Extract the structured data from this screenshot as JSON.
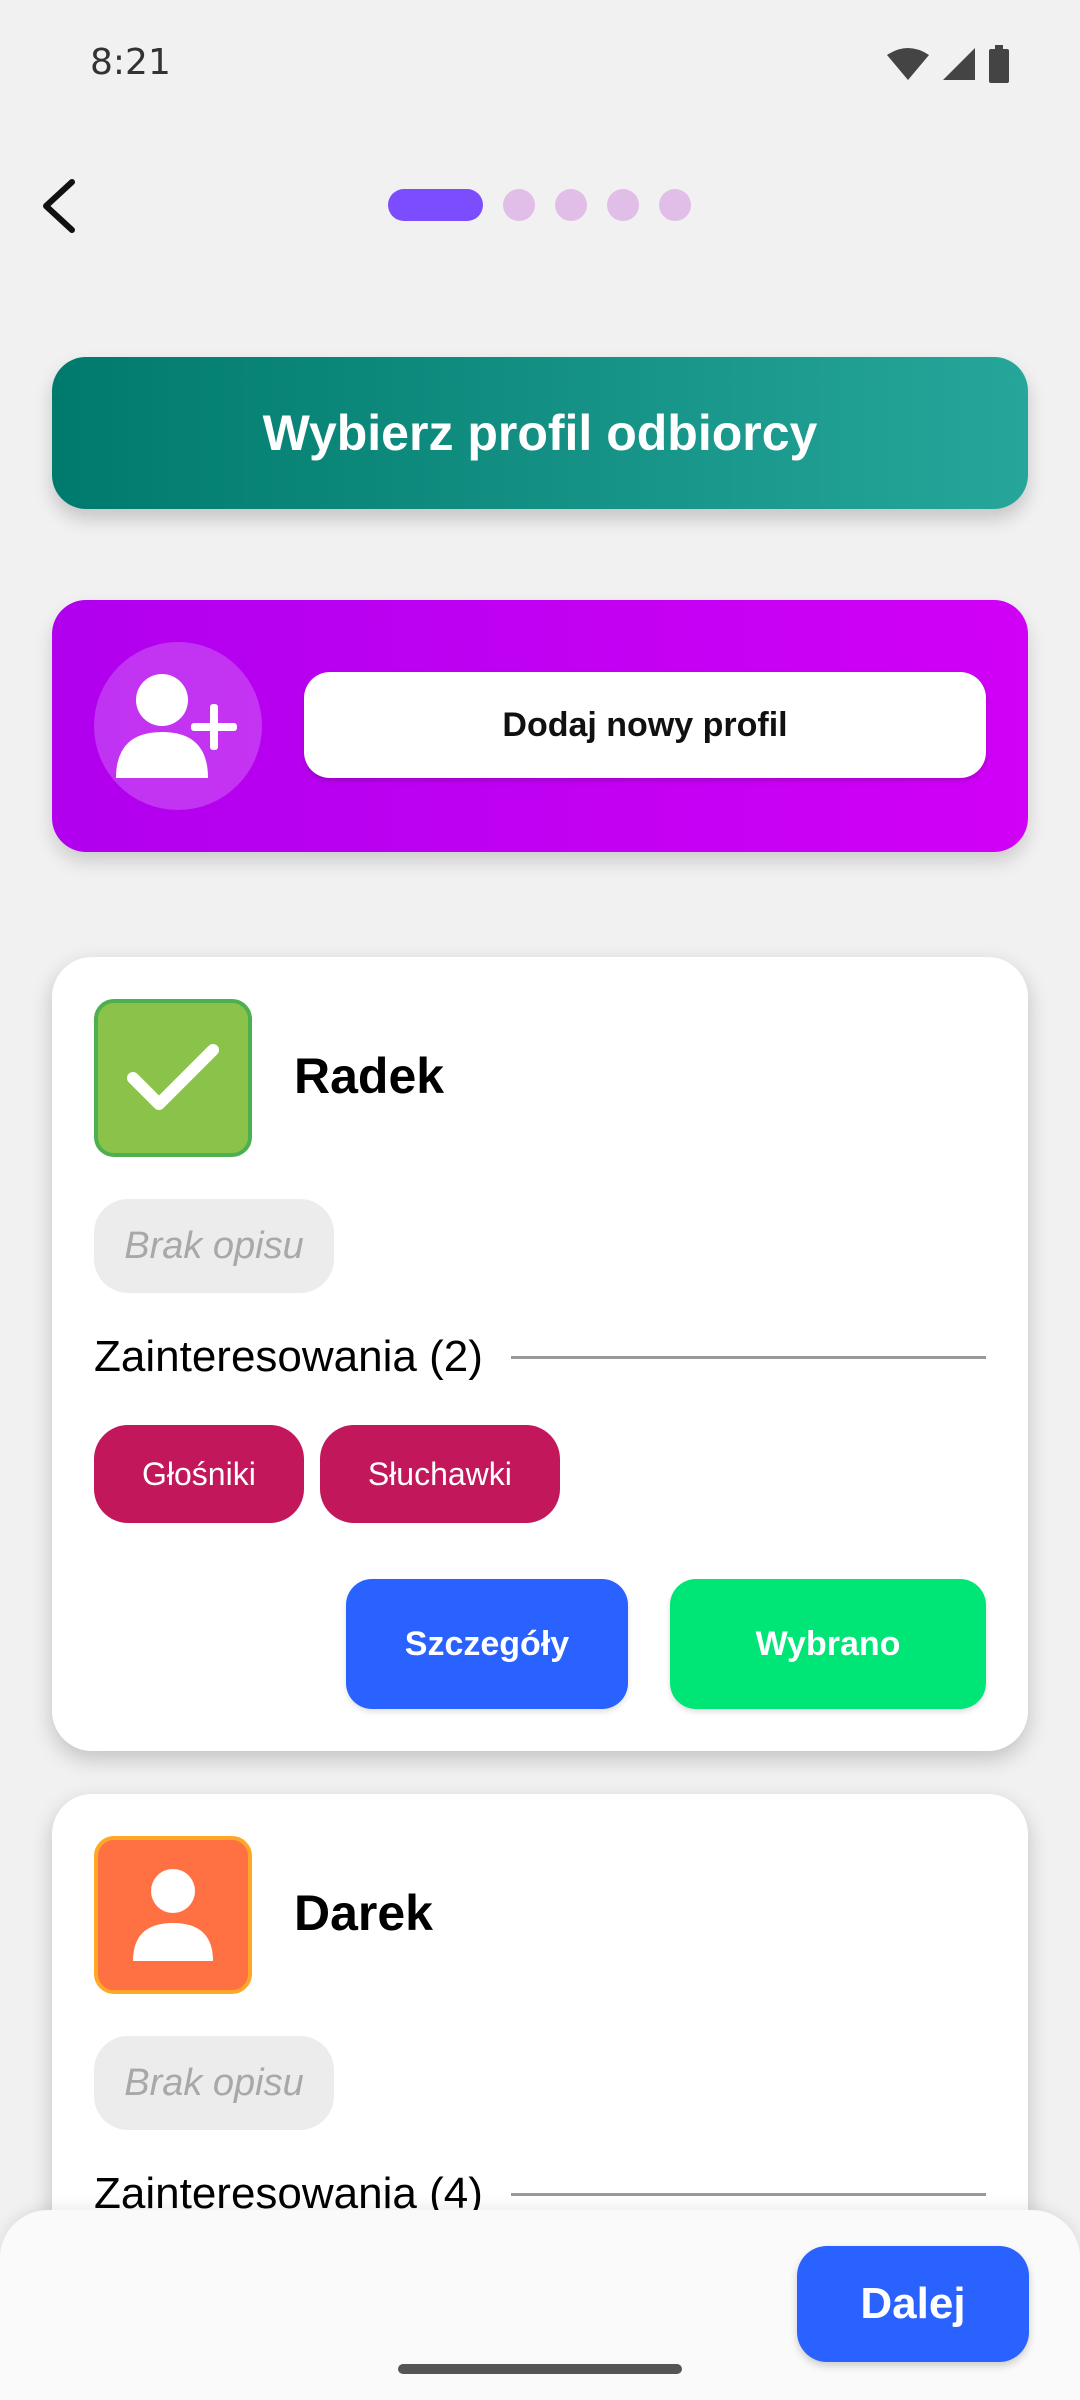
{
  "status_bar": {
    "time": "8:21",
    "icons": [
      "wifi-icon",
      "signal-icon",
      "battery-icon"
    ]
  },
  "header": {
    "back_icon": "arrow-back-icon",
    "pager": {
      "total": 5,
      "active_index": 0
    }
  },
  "title_banner": {
    "label": "Wybierz profil odbiorcy"
  },
  "add_profile": {
    "icon": "person-add-icon",
    "button_label": "Dodaj nowy profil"
  },
  "profiles": [
    {
      "name": "Radek",
      "avatar_icon": "check-icon",
      "description": "Brak opisu",
      "interests_title": "Zainteresowania (2)",
      "tags": [
        "Głośniki",
        "Słuchawki"
      ],
      "details_label": "Szczegóły",
      "select_label": "Wybrano"
    },
    {
      "name": "Darek",
      "avatar_icon": "person-icon",
      "description": "Brak opisu",
      "interests_title": "Zainteresowania (4)"
    }
  ],
  "footer": {
    "next_label": "Dalej"
  },
  "colors": {
    "title_gradient": [
      "#007a6c",
      "#26a69a"
    ],
    "add_gradient": [
      "#b000ee",
      "#d100f6"
    ],
    "tag": "#c2185b",
    "details_button": "#2962ff",
    "selected_button": "#00e676",
    "pager_active": "#7c4dff",
    "pager_inactive": "#e1bee7"
  }
}
